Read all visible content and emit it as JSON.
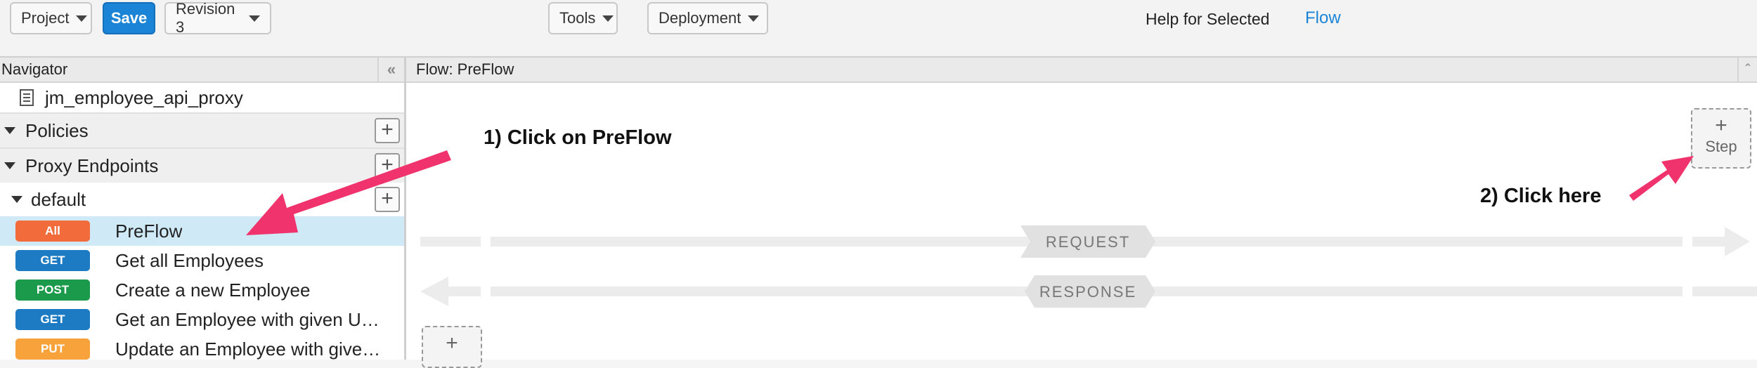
{
  "toolbar": {
    "project_label": "Project",
    "save_label": "Save",
    "revision_label": "Revision 3",
    "tools_label": "Tools",
    "deployment_label": "Deployment",
    "help_label": "Help for Selected",
    "help_link": "Flow"
  },
  "navigator": {
    "title": "Navigator",
    "collapse_glyph": "«",
    "proxy_name": "jm_employee_api_proxy",
    "policies_label": "Policies",
    "proxy_endpoints_label": "Proxy Endpoints",
    "default_label": "default",
    "flows": [
      {
        "badge": "All",
        "name": "PreFlow",
        "color": "#f26b3a",
        "selected": true
      },
      {
        "badge": "GET",
        "name": "Get all Employees",
        "color": "#1c7bc2",
        "selected": false
      },
      {
        "badge": "POST",
        "name": "Create a new Employee",
        "color": "#1a9a4a",
        "selected": false
      },
      {
        "badge": "GET",
        "name": "Get an Employee with given U…",
        "color": "#1c7bc2",
        "selected": false
      },
      {
        "badge": "PUT",
        "name": "Update an Employee with give…",
        "color": "#f7a23b",
        "selected": false
      }
    ]
  },
  "flow_panel": {
    "title": "Flow: PreFlow",
    "step_plus": "+",
    "step_label": "Step",
    "bottom_plus": "+",
    "request_label": "REQUEST",
    "response_label": "RESPONSE"
  },
  "annotations": {
    "step1": "1) Click on PreFlow",
    "step2": "2) Click here",
    "arrow_color": "#f0336c"
  },
  "colors": {
    "accent": "#1c84d6",
    "selected_row": "#cfe9f7"
  }
}
